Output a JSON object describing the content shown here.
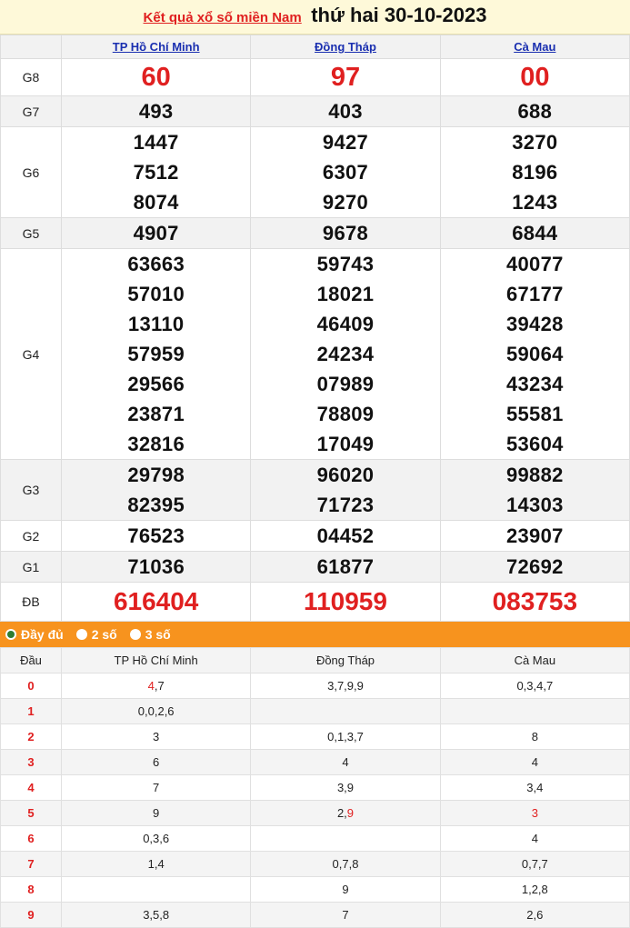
{
  "header": {
    "link_text": "Kết quả xổ số miền Nam",
    "date_text": "thứ hai 30-10-2023"
  },
  "provinces": [
    "TP Hồ Chí Minh",
    "Đồng Tháp",
    "Cà Mau"
  ],
  "prizes": {
    "G8": [
      "60",
      "97",
      "00"
    ],
    "G7": [
      "493",
      "403",
      "688"
    ],
    "G6": [
      [
        "1447",
        "7512",
        "8074"
      ],
      [
        "9427",
        "6307",
        "9270"
      ],
      [
        "3270",
        "8196",
        "1243"
      ]
    ],
    "G5": [
      "4907",
      "9678",
      "6844"
    ],
    "G4": [
      [
        "63663",
        "57010",
        "13110",
        "57959",
        "29566",
        "23871",
        "32816"
      ],
      [
        "59743",
        "18021",
        "46409",
        "24234",
        "07989",
        "78809",
        "17049"
      ],
      [
        "40077",
        "67177",
        "39428",
        "59064",
        "43234",
        "55581",
        "53604"
      ]
    ],
    "G3": [
      [
        "29798",
        "82395"
      ],
      [
        "96020",
        "71723"
      ],
      [
        "99882",
        "14303"
      ]
    ],
    "G2": [
      "76523",
      "04452",
      "23907"
    ],
    "G1": [
      "71036",
      "61877",
      "72692"
    ],
    "DB": [
      "616404",
      "110959",
      "083753"
    ]
  },
  "prize_labels": {
    "G8": "G8",
    "G7": "G7",
    "G6": "G6",
    "G5": "G5",
    "G4": "G4",
    "G3": "G3",
    "G2": "G2",
    "G1": "G1",
    "DB": "ĐB"
  },
  "options": [
    "Đầy đủ",
    "2 số",
    "3 số"
  ],
  "dau_header": "Đầu",
  "dau_rows": [
    {
      "d": "0",
      "c": [
        [
          [
            "4",
            "r"
          ],
          [
            ",7",
            ""
          ]
        ],
        [
          [
            "3,7,9,9",
            ""
          ]
        ],
        [
          [
            "0,3,4,7",
            ""
          ]
        ]
      ]
    },
    {
      "d": "1",
      "c": [
        [
          [
            "0,0,2,6",
            ""
          ]
        ],
        [],
        []
      ]
    },
    {
      "d": "2",
      "c": [
        [
          [
            "3",
            ""
          ]
        ],
        [
          [
            "0,1,3,7",
            ""
          ]
        ],
        [
          [
            "8",
            ""
          ]
        ]
      ]
    },
    {
      "d": "3",
      "c": [
        [
          [
            "6",
            ""
          ]
        ],
        [
          [
            "4",
            ""
          ]
        ],
        [
          [
            "4",
            ""
          ]
        ]
      ]
    },
    {
      "d": "4",
      "c": [
        [
          [
            "7",
            ""
          ]
        ],
        [
          [
            "3,9",
            ""
          ]
        ],
        [
          [
            "3,4",
            ""
          ]
        ]
      ]
    },
    {
      "d": "5",
      "c": [
        [
          [
            "9",
            ""
          ]
        ],
        [
          [
            "2,",
            ""
          ],
          [
            "9",
            "r"
          ]
        ],
        [
          [
            "3",
            "r"
          ]
        ]
      ]
    },
    {
      "d": "6",
      "c": [
        [
          [
            "0,3,6",
            ""
          ]
        ],
        [],
        [
          [
            "4",
            ""
          ]
        ]
      ]
    },
    {
      "d": "7",
      "c": [
        [
          [
            "1,4",
            ""
          ]
        ],
        [
          [
            "0,7,8",
            ""
          ]
        ],
        [
          [
            "0,7,7",
            ""
          ]
        ]
      ]
    },
    {
      "d": "8",
      "c": [
        [],
        [
          [
            "9",
            ""
          ]
        ],
        [
          [
            "1,2,8",
            ""
          ]
        ]
      ]
    },
    {
      "d": "9",
      "c": [
        [
          [
            "3,5,8",
            ""
          ]
        ],
        [
          [
            "7",
            ""
          ]
        ],
        [
          [
            "2,6",
            ""
          ]
        ]
      ]
    }
  ],
  "colors": {
    "accent": "#f7931e",
    "red": "#e02020",
    "link": "#1a2fb0",
    "header_bg": "#fef9d9"
  }
}
